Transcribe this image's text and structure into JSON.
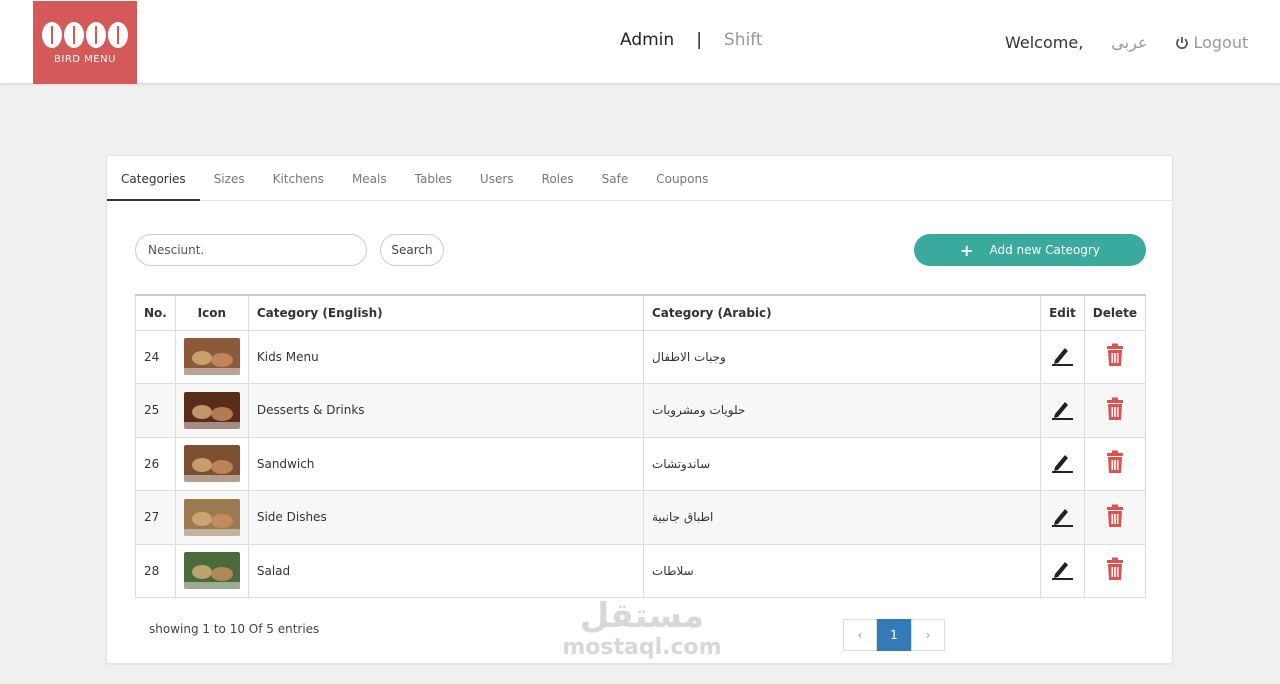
{
  "brand": {
    "logo_text": "BIRD MENU"
  },
  "header": {
    "admin_label": "Admin",
    "separator": "|",
    "shift_label": "Shift",
    "welcome": "Welcome,",
    "language": "عربى",
    "logout": "Logout"
  },
  "tabs": [
    "Categories",
    "Sizes",
    "Kitchens",
    "Meals",
    "Tables",
    "Users",
    "Roles",
    "Safe",
    "Coupons"
  ],
  "search": {
    "value": "Nesciunt.",
    "button_label": "Search"
  },
  "add_button_label": "Add new Cateogry",
  "table": {
    "headers": [
      "No.",
      "Icon",
      "Category (English)",
      "Category (Arabic)",
      "Edit",
      "Delete"
    ],
    "rows": [
      {
        "no": "24",
        "english": "Kids Menu",
        "arabic": "وجبات الاطفال",
        "thumb_color": "#8a5a3a"
      },
      {
        "no": "25",
        "english": "Desserts & Drinks",
        "arabic": "حلويات ومشروبات",
        "thumb_color": "#5a2a1a"
      },
      {
        "no": "26",
        "english": "Sandwich",
        "arabic": "ساندوتشات",
        "thumb_color": "#7a5030"
      },
      {
        "no": "27",
        "english": "Side Dishes",
        "arabic": "اطباق جانبية",
        "thumb_color": "#9a7a50"
      },
      {
        "no": "28",
        "english": "Salad",
        "arabic": "سلاطات",
        "thumb_color": "#4a6a3a"
      }
    ]
  },
  "footer": {
    "entries_text": "showing 1 to 10 Of 5 entries",
    "prev": "‹",
    "current_page": "1",
    "next": "›"
  },
  "watermark": {
    "arabic": "مستقل",
    "latin": "mostaql.com"
  },
  "colors": {
    "brand": "#d45a5a",
    "accent": "#3aaa9f",
    "pager_active": "#337ab7",
    "delete": "#d9534f"
  }
}
